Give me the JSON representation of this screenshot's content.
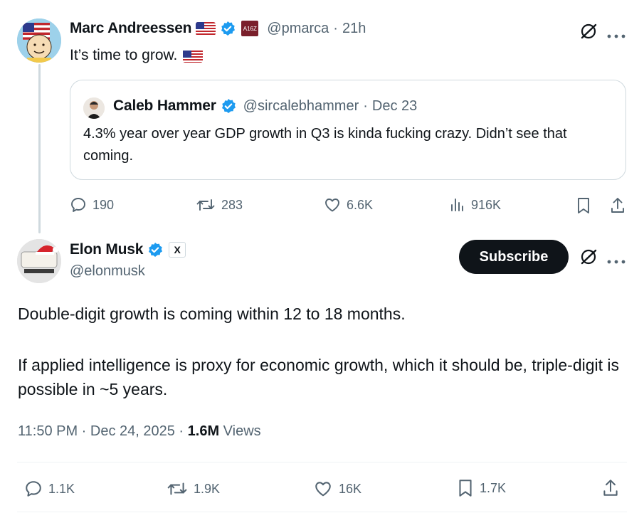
{
  "tweet1": {
    "author_name": "Marc Andreessen",
    "handle": "@pmarca",
    "time": "21h",
    "text": "It’s time to grow.",
    "affiliate_badge": "A16Z",
    "quote": {
      "author_name": "Caleb Hammer",
      "handle": "@sircalebhammer",
      "date": "Dec 23",
      "text": "4.3% year over year GDP growth in Q3 is kinda fucking crazy. Didn’t see that coming."
    },
    "stats": {
      "replies": "190",
      "reposts": "283",
      "likes": "6.6K",
      "views": "916K"
    }
  },
  "tweet2": {
    "author_name": "Elon Musk",
    "handle": "@elonmusk",
    "affiliate_badge": "X",
    "subscribe_label": "Subscribe",
    "paragraph1": "Double-digit growth is coming within 12 to 18 months.",
    "paragraph2": "If applied intelligence is proxy for economic growth, which it should be, triple-digit is possible in ~5 years.",
    "timestamp": "11:50 PM · Dec 24, 2025 · ",
    "views_count": "1.6M",
    "views_label": " Views",
    "stats": {
      "replies": "1.1K",
      "reposts": "1.9K",
      "likes": "16K",
      "bookmarks": "1.7K"
    }
  },
  "separator": " · ",
  "colors": {
    "verified": "#1d9bf0",
    "text": "#0f1419",
    "muted": "#536471",
    "border": "#cfd9de"
  },
  "icons": [
    "verified-icon",
    "us-flag-icon",
    "grok-icon",
    "more-icon",
    "reply-icon",
    "repost-icon",
    "like-icon",
    "views-icon",
    "bookmark-icon",
    "share-icon",
    "x-logo-icon"
  ]
}
